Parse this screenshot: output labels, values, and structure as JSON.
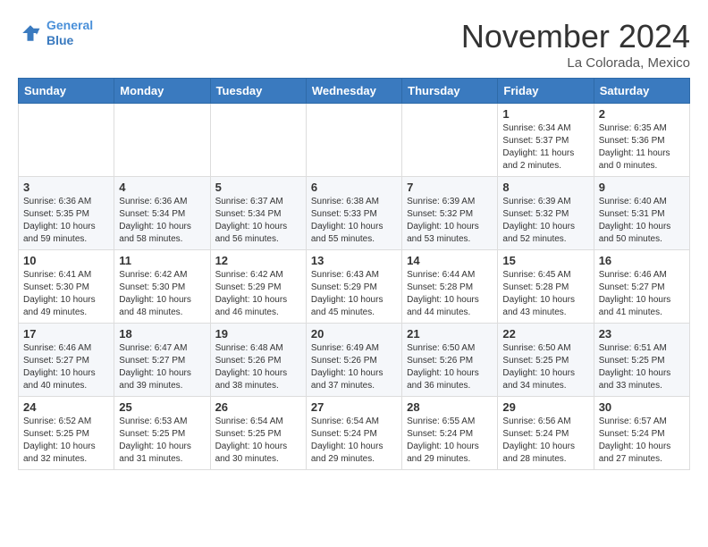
{
  "header": {
    "logo_line1": "General",
    "logo_line2": "Blue",
    "month": "November 2024",
    "location": "La Colorada, Mexico"
  },
  "weekdays": [
    "Sunday",
    "Monday",
    "Tuesday",
    "Wednesday",
    "Thursday",
    "Friday",
    "Saturday"
  ],
  "weeks": [
    [
      {
        "day": "",
        "info": ""
      },
      {
        "day": "",
        "info": ""
      },
      {
        "day": "",
        "info": ""
      },
      {
        "day": "",
        "info": ""
      },
      {
        "day": "",
        "info": ""
      },
      {
        "day": "1",
        "info": "Sunrise: 6:34 AM\nSunset: 5:37 PM\nDaylight: 11 hours\nand 2 minutes."
      },
      {
        "day": "2",
        "info": "Sunrise: 6:35 AM\nSunset: 5:36 PM\nDaylight: 11 hours\nand 0 minutes."
      }
    ],
    [
      {
        "day": "3",
        "info": "Sunrise: 6:36 AM\nSunset: 5:35 PM\nDaylight: 10 hours\nand 59 minutes."
      },
      {
        "day": "4",
        "info": "Sunrise: 6:36 AM\nSunset: 5:34 PM\nDaylight: 10 hours\nand 58 minutes."
      },
      {
        "day": "5",
        "info": "Sunrise: 6:37 AM\nSunset: 5:34 PM\nDaylight: 10 hours\nand 56 minutes."
      },
      {
        "day": "6",
        "info": "Sunrise: 6:38 AM\nSunset: 5:33 PM\nDaylight: 10 hours\nand 55 minutes."
      },
      {
        "day": "7",
        "info": "Sunrise: 6:39 AM\nSunset: 5:32 PM\nDaylight: 10 hours\nand 53 minutes."
      },
      {
        "day": "8",
        "info": "Sunrise: 6:39 AM\nSunset: 5:32 PM\nDaylight: 10 hours\nand 52 minutes."
      },
      {
        "day": "9",
        "info": "Sunrise: 6:40 AM\nSunset: 5:31 PM\nDaylight: 10 hours\nand 50 minutes."
      }
    ],
    [
      {
        "day": "10",
        "info": "Sunrise: 6:41 AM\nSunset: 5:30 PM\nDaylight: 10 hours\nand 49 minutes."
      },
      {
        "day": "11",
        "info": "Sunrise: 6:42 AM\nSunset: 5:30 PM\nDaylight: 10 hours\nand 48 minutes."
      },
      {
        "day": "12",
        "info": "Sunrise: 6:42 AM\nSunset: 5:29 PM\nDaylight: 10 hours\nand 46 minutes."
      },
      {
        "day": "13",
        "info": "Sunrise: 6:43 AM\nSunset: 5:29 PM\nDaylight: 10 hours\nand 45 minutes."
      },
      {
        "day": "14",
        "info": "Sunrise: 6:44 AM\nSunset: 5:28 PM\nDaylight: 10 hours\nand 44 minutes."
      },
      {
        "day": "15",
        "info": "Sunrise: 6:45 AM\nSunset: 5:28 PM\nDaylight: 10 hours\nand 43 minutes."
      },
      {
        "day": "16",
        "info": "Sunrise: 6:46 AM\nSunset: 5:27 PM\nDaylight: 10 hours\nand 41 minutes."
      }
    ],
    [
      {
        "day": "17",
        "info": "Sunrise: 6:46 AM\nSunset: 5:27 PM\nDaylight: 10 hours\nand 40 minutes."
      },
      {
        "day": "18",
        "info": "Sunrise: 6:47 AM\nSunset: 5:27 PM\nDaylight: 10 hours\nand 39 minutes."
      },
      {
        "day": "19",
        "info": "Sunrise: 6:48 AM\nSunset: 5:26 PM\nDaylight: 10 hours\nand 38 minutes."
      },
      {
        "day": "20",
        "info": "Sunrise: 6:49 AM\nSunset: 5:26 PM\nDaylight: 10 hours\nand 37 minutes."
      },
      {
        "day": "21",
        "info": "Sunrise: 6:50 AM\nSunset: 5:26 PM\nDaylight: 10 hours\nand 36 minutes."
      },
      {
        "day": "22",
        "info": "Sunrise: 6:50 AM\nSunset: 5:25 PM\nDaylight: 10 hours\nand 34 minutes."
      },
      {
        "day": "23",
        "info": "Sunrise: 6:51 AM\nSunset: 5:25 PM\nDaylight: 10 hours\nand 33 minutes."
      }
    ],
    [
      {
        "day": "24",
        "info": "Sunrise: 6:52 AM\nSunset: 5:25 PM\nDaylight: 10 hours\nand 32 minutes."
      },
      {
        "day": "25",
        "info": "Sunrise: 6:53 AM\nSunset: 5:25 PM\nDaylight: 10 hours\nand 31 minutes."
      },
      {
        "day": "26",
        "info": "Sunrise: 6:54 AM\nSunset: 5:25 PM\nDaylight: 10 hours\nand 30 minutes."
      },
      {
        "day": "27",
        "info": "Sunrise: 6:54 AM\nSunset: 5:24 PM\nDaylight: 10 hours\nand 29 minutes."
      },
      {
        "day": "28",
        "info": "Sunrise: 6:55 AM\nSunset: 5:24 PM\nDaylight: 10 hours\nand 29 minutes."
      },
      {
        "day": "29",
        "info": "Sunrise: 6:56 AM\nSunset: 5:24 PM\nDaylight: 10 hours\nand 28 minutes."
      },
      {
        "day": "30",
        "info": "Sunrise: 6:57 AM\nSunset: 5:24 PM\nDaylight: 10 hours\nand 27 minutes."
      }
    ]
  ]
}
